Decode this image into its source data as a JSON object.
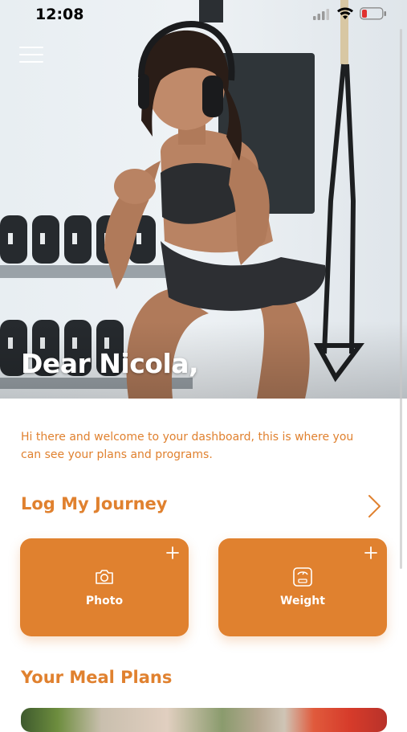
{
  "status_bar": {
    "time": "12:08"
  },
  "hero": {
    "greeting": "Dear Nicola,"
  },
  "intro_text": "Hi there and welcome to your dashboard, this is where you can see your plans and programs.",
  "journey": {
    "title": "Log My Journey",
    "cards": [
      {
        "label": "Photo",
        "icon": "camera-icon"
      },
      {
        "label": "Weight",
        "icon": "scale-icon"
      }
    ]
  },
  "meal_plans": {
    "title": "Your Meal Plans"
  },
  "colors": {
    "accent": "#e0812f",
    "card_text": "#ffffff"
  }
}
